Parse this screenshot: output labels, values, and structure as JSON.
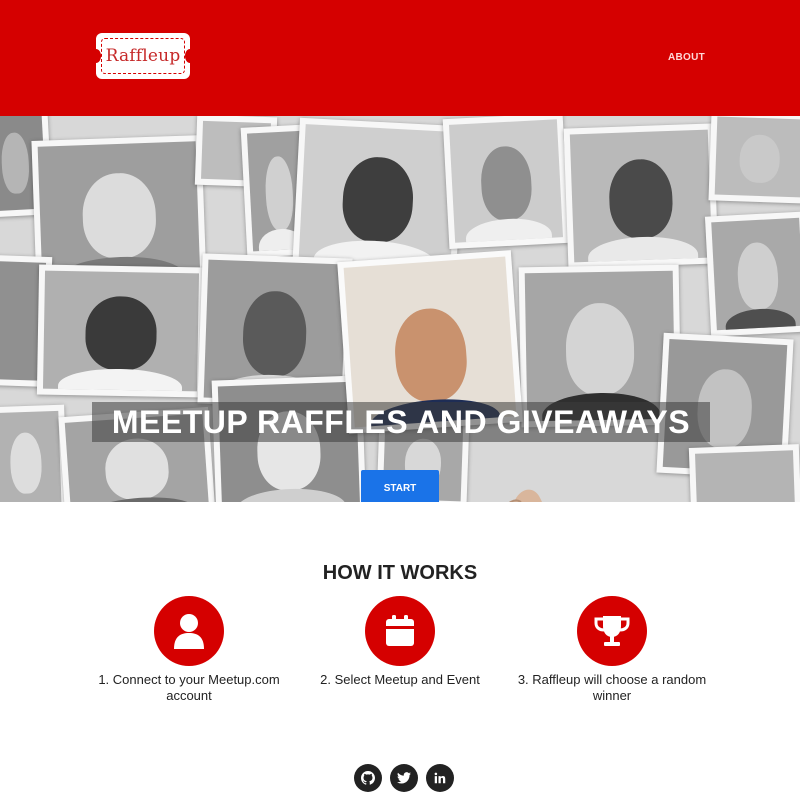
{
  "header": {
    "logo_text": "Raffleup",
    "nav": {
      "about_label": "ABOUT"
    }
  },
  "hero": {
    "title": "MEETUP RAFFLES AND GIVEAWAYS",
    "start_label": "START"
  },
  "how_it_works": {
    "title": "HOW IT WORKS",
    "steps": [
      {
        "icon": "user-icon",
        "text": "1. Connect to your Meetup.com account"
      },
      {
        "icon": "calendar-icon",
        "text": "2. Select Meetup and Event"
      },
      {
        "icon": "trophy-icon",
        "text": "3. Raffleup will choose a random winner"
      }
    ]
  },
  "footer": {
    "social": [
      "github-icon",
      "twitter-icon",
      "linkedin-icon"
    ]
  },
  "colors": {
    "brand_red": "#d50000",
    "button_blue": "#1a73e8",
    "social_dark": "#222222"
  }
}
